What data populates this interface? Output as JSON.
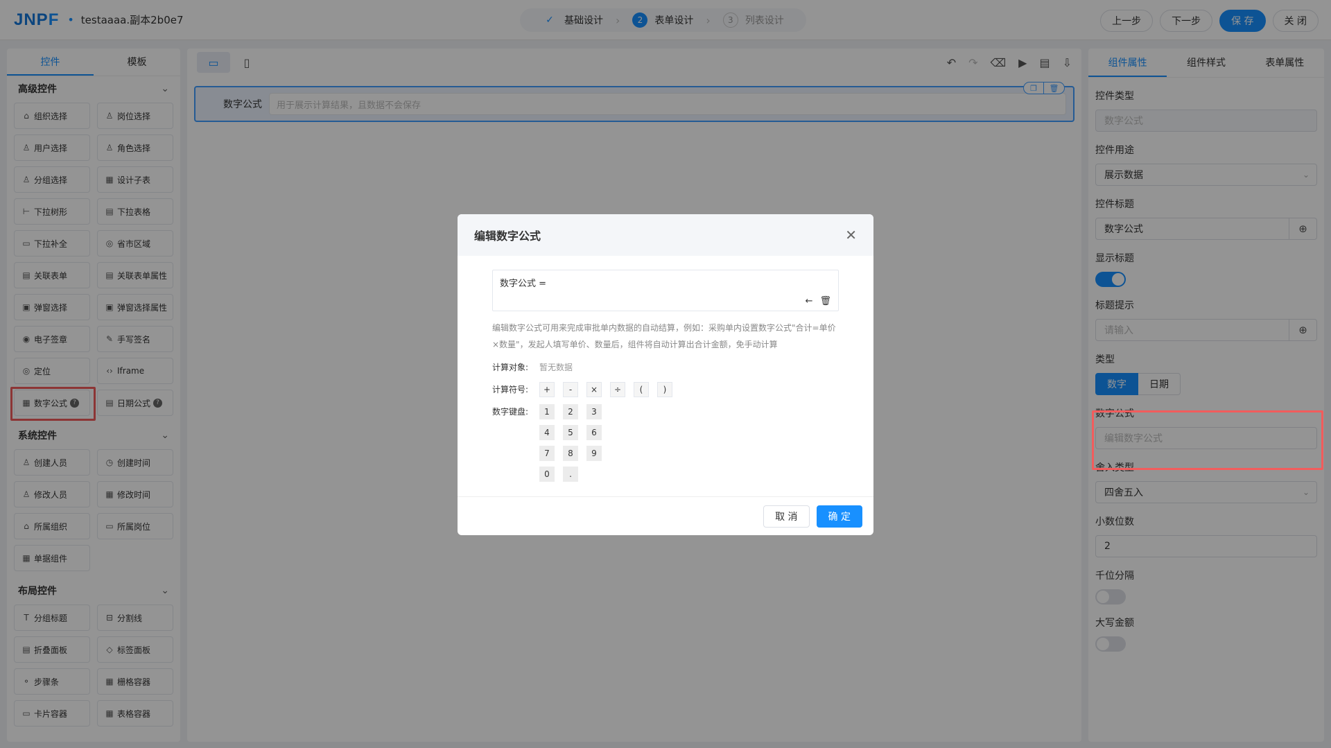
{
  "header": {
    "logo_a": "JNP",
    "logo_b": "F",
    "dot": "•",
    "project": "testaaaa.副本2b0e7",
    "steps": [
      {
        "num": "✓",
        "label": "基础设计"
      },
      {
        "num": "2",
        "label": "表单设计"
      },
      {
        "num": "3",
        "label": "列表设计"
      }
    ],
    "sep": "›",
    "buttons": {
      "prev": "上一步",
      "next": "下一步",
      "save": "保 存",
      "close": "关 闭"
    }
  },
  "left": {
    "tabs": [
      "控件",
      "模板"
    ],
    "sections": [
      {
        "title": "高级控件",
        "items": [
          {
            "icon": "⌂",
            "label": "组织选择"
          },
          {
            "icon": "♙",
            "label": "岗位选择"
          },
          {
            "icon": "♙",
            "label": "用户选择"
          },
          {
            "icon": "♙",
            "label": "角色选择"
          },
          {
            "icon": "♙",
            "label": "分组选择"
          },
          {
            "icon": "▦",
            "label": "设计子表"
          },
          {
            "icon": "⊢",
            "label": "下拉树形"
          },
          {
            "icon": "▤",
            "label": "下拉表格"
          },
          {
            "icon": "▭",
            "label": "下拉补全"
          },
          {
            "icon": "◎",
            "label": "省市区域"
          },
          {
            "icon": "▤",
            "label": "关联表单"
          },
          {
            "icon": "▤",
            "label": "关联表单属性"
          },
          {
            "icon": "▣",
            "label": "弹窗选择"
          },
          {
            "icon": "▣",
            "label": "弹窗选择属性"
          },
          {
            "icon": "◉",
            "label": "电子签章"
          },
          {
            "icon": "✎",
            "label": "手写签名"
          },
          {
            "icon": "◎",
            "label": "定位"
          },
          {
            "icon": "‹›",
            "label": "Iframe"
          },
          {
            "icon": "▦",
            "label": "数字公式",
            "help": "?"
          },
          {
            "icon": "▤",
            "label": "日期公式",
            "help": "?"
          }
        ]
      },
      {
        "title": "系统控件",
        "items": [
          {
            "icon": "♙",
            "label": "创建人员"
          },
          {
            "icon": "◷",
            "label": "创建时间"
          },
          {
            "icon": "♙",
            "label": "修改人员"
          },
          {
            "icon": "▦",
            "label": "修改时间"
          },
          {
            "icon": "⌂",
            "label": "所属组织"
          },
          {
            "icon": "▭",
            "label": "所属岗位"
          },
          {
            "icon": "▦",
            "label": "单据组件"
          }
        ]
      },
      {
        "title": "布局控件",
        "items": [
          {
            "icon": "T",
            "label": "分组标题"
          },
          {
            "icon": "⊟",
            "label": "分割线"
          },
          {
            "icon": "▤",
            "label": "折叠面板"
          },
          {
            "icon": "◇",
            "label": "标签面板"
          },
          {
            "icon": "⚬",
            "label": "步骤条"
          },
          {
            "icon": "▦",
            "label": "栅格容器"
          },
          {
            "icon": "▭",
            "label": "卡片容器"
          },
          {
            "icon": "▦",
            "label": "表格容器"
          }
        ]
      }
    ],
    "chevron": "⌄"
  },
  "center": {
    "field_label": "数字公式",
    "field_placeholder": "用于展示计算结果，且数据不会保存",
    "copy_icon": "❐",
    "delete_icon": "🗑"
  },
  "right": {
    "tabs": [
      "组件属性",
      "组件样式",
      "表单属性"
    ],
    "control_type_label": "控件类型",
    "control_type_value": "数字公式",
    "usage_label": "控件用途",
    "usage_value": "展示数据",
    "title_label": "控件标题",
    "title_value": "数字公式",
    "show_title_label": "显示标题",
    "tip_label": "标题提示",
    "tip_placeholder": "请输入",
    "type_label": "类型",
    "type_options": [
      "数字",
      "日期"
    ],
    "formula_label": "数字公式",
    "formula_placeholder": "编辑数字公式",
    "round_label": "舍入类型",
    "round_value": "四舍五入",
    "decimal_label": "小数位数",
    "decimal_value": "2",
    "thousand_label": "千位分隔",
    "upper_label": "大写金额"
  },
  "modal": {
    "title": "编辑数字公式",
    "close": "✕",
    "formula_text": "数字公式 =",
    "back_icon": "←",
    "trash_icon": "🗑",
    "desc": "编辑数字公式可用来完成审批单内数据的自动结算，例如：采购单内设置数字公式\"合计=单价×数量\"，发起人填写单价、数量后，组件将自动计算出合计金额，免手动计算",
    "object_label": "计算对象:",
    "object_value": "暂无数据",
    "ops_label": "计算符号:",
    "ops": [
      "+",
      "-",
      "×",
      "÷",
      "(",
      ")"
    ],
    "keypad_label": "数字键盘:",
    "keys": [
      "1",
      "2",
      "3",
      "4",
      "5",
      "6",
      "7",
      "8",
      "9",
      "0",
      "."
    ],
    "cancel": "取 消",
    "confirm": "确 定"
  }
}
